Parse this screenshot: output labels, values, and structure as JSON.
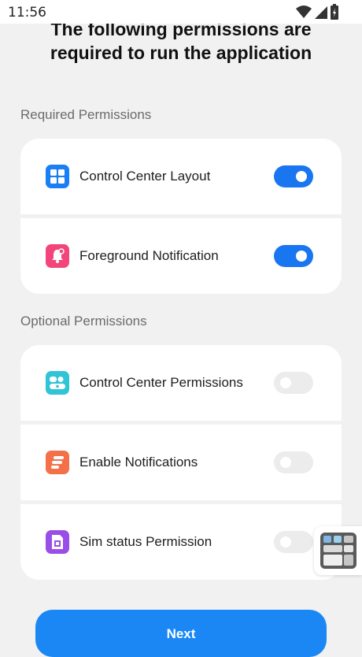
{
  "status_bar": {
    "time": "11:56",
    "icons": [
      "wifi-icon",
      "cellular-signal-icon",
      "battery-charging-icon"
    ]
  },
  "header": {
    "title_line1": "The following permissions are",
    "title_line2": "required to run the application"
  },
  "required_section": {
    "label": "Required Permissions",
    "items": [
      {
        "label": "Control Center Layout",
        "icon": "grid-icon",
        "icon_color": "#1a7ef5",
        "enabled": true
      },
      {
        "label": "Foreground Notification",
        "icon": "bell-icon",
        "icon_color": "#f2457b",
        "enabled": true
      }
    ]
  },
  "optional_section": {
    "label": "Optional Permissions",
    "items": [
      {
        "label": "Control Center Permissions",
        "icon": "control-center-icon",
        "icon_color": "#2fc4d6",
        "enabled": false
      },
      {
        "label": "Enable Notifications",
        "icon": "notification-lines-icon",
        "icon_color": "#f47049",
        "enabled": false
      },
      {
        "label": "Sim status Permission",
        "icon": "sim-card-icon",
        "icon_color": "#9a4ee8",
        "enabled": false
      }
    ]
  },
  "next_button": {
    "label": "Next"
  },
  "colors": {
    "toggle_on": "#1976f0",
    "toggle_off": "#ececec",
    "button": "#1a87f5",
    "background": "#f1f1f1"
  }
}
